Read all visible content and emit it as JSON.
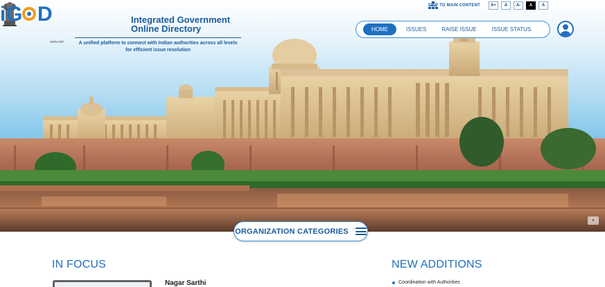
{
  "utility": {
    "skip_label": "SKIP TO MAIN CONTENT",
    "font_buttons": [
      "A+",
      "A",
      "A-",
      "A",
      "A"
    ]
  },
  "header": {
    "emblem_caption": "सत्यमेव जयते",
    "logo_text": "iGOD",
    "title_line1": "Integrated Government",
    "title_line2": "Online Directory",
    "tagline": "A unified platform to connect with Indian authorities across all levels for efficient issue resolution"
  },
  "nav": {
    "items": [
      "HOME",
      "ISSUES",
      "RAISE ISSUE",
      "ISSUE STATUS"
    ],
    "active": "HOME"
  },
  "hero": {
    "org_categories_label": "ORGANIZATION CATEGORIES",
    "slider_control": "⏸"
  },
  "in_focus": {
    "title": "IN FOCUS",
    "item_name": "Nagar Sarthi"
  },
  "new_additions": {
    "title": "NEW ADDITIONS",
    "items": [
      "Coordination with Authorities"
    ]
  },
  "colors": {
    "brand_blue": "#1f6fc0",
    "text_blue": "#1a5a9c"
  }
}
